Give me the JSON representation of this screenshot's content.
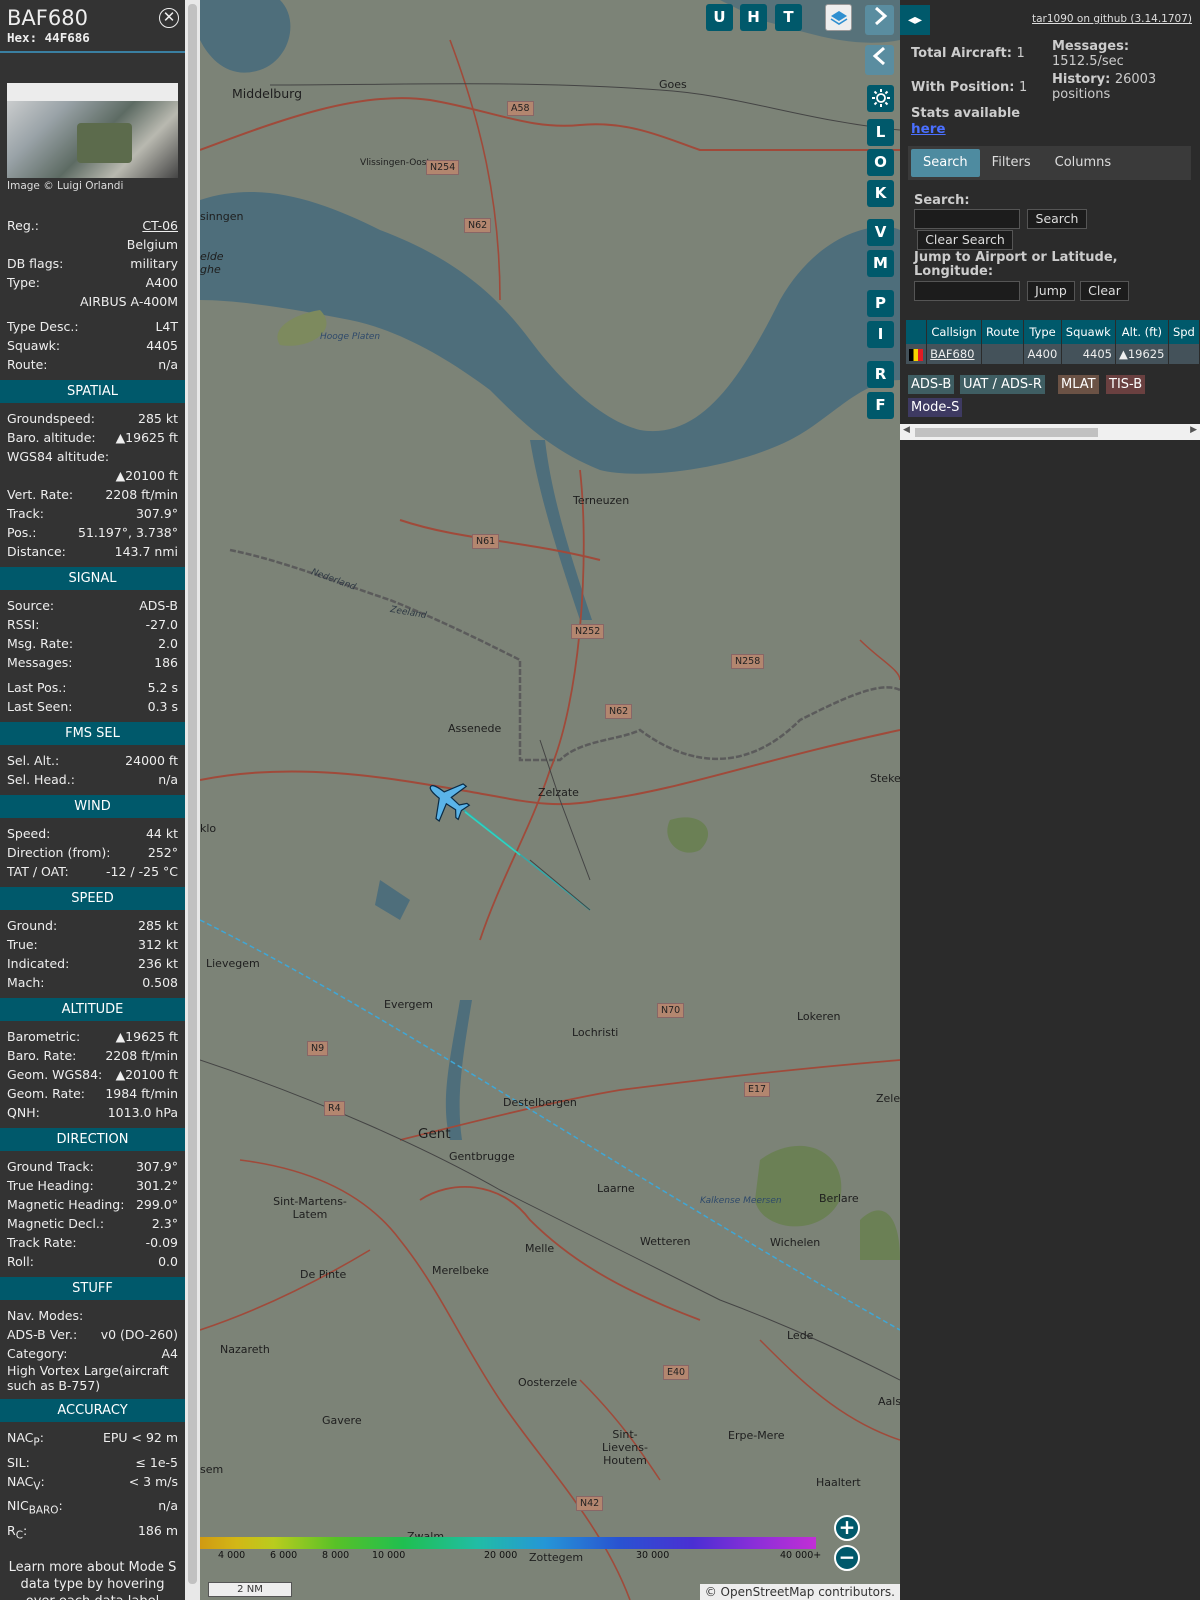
{
  "info": {
    "callsign": "BAF680",
    "hex_label": "Hex:",
    "hex": "44F686",
    "close_icon": "close-icon",
    "photo_credit": "Image © Luigi Orlandi",
    "reg_label": "Reg.:",
    "reg": "CT-06",
    "country": "Belgium",
    "dbflags_label": "DB flags:",
    "dbflags": "military",
    "type_label": "Type:",
    "type": "A400",
    "type_full": "AIRBUS A-400M",
    "typedesc_label": "Type Desc.:",
    "typedesc": "L4T",
    "squawk_label": "Squawk:",
    "squawk": "4405",
    "route_label": "Route:",
    "route": "n/a",
    "footer": "Learn more about Mode S data type by hovering over each data label"
  },
  "spatial": {
    "title": "SPATIAL",
    "groundspeed_label": "Groundspeed:",
    "groundspeed": "285 kt",
    "baro_label": "Baro. altitude:",
    "baro": "▲19625 ft",
    "wgs_label": "WGS84 altitude:",
    "wgs": "▲20100 ft",
    "vrate_label": "Vert. Rate:",
    "vrate": "2208 ft/min",
    "track_label": "Track:",
    "track": "307.9°",
    "pos_label": "Pos.:",
    "pos": "51.197°, 3.738°",
    "dist_label": "Distance:",
    "dist": "143.7 nmi"
  },
  "signal": {
    "title": "SIGNAL",
    "source_label": "Source:",
    "source": "ADS-B",
    "rssi_label": "RSSI:",
    "rssi": "-27.0",
    "msgrate_label": "Msg. Rate:",
    "msgrate": "2.0",
    "messages_label": "Messages:",
    "messages": "186",
    "lastpos_label": "Last Pos.:",
    "lastpos": "5.2 s",
    "lastseen_label": "Last Seen:",
    "lastseen": "0.3 s"
  },
  "fms": {
    "title": "FMS SEL",
    "selalt_label": "Sel. Alt.:",
    "selalt": "24000 ft",
    "selhead_label": "Sel. Head.:",
    "selhead": "n/a"
  },
  "wind": {
    "title": "WIND",
    "speed_label": "Speed:",
    "speed": "44 kt",
    "dir_label": "Direction (from):",
    "dir": "252°",
    "tat_label": "TAT / OAT:",
    "tat": "-12 / -25 °C"
  },
  "speed": {
    "title": "SPEED",
    "ground_label": "Ground:",
    "ground": "285 kt",
    "true_label": "True:",
    "true": "312 kt",
    "ind_label": "Indicated:",
    "ind": "236 kt",
    "mach_label": "Mach:",
    "mach": "0.508"
  },
  "altitude": {
    "title": "ALTITUDE",
    "baro_label": "Barometric:",
    "baro": "▲19625 ft",
    "barorate_label": "Baro. Rate:",
    "barorate": "2208 ft/min",
    "geom_label": "Geom. WGS84:",
    "geom": "▲20100 ft",
    "geomrate_label": "Geom. Rate:",
    "geomrate": "1984 ft/min",
    "qnh_label": "QNH:",
    "qnh": "1013.0 hPa"
  },
  "direction": {
    "title": "DIRECTION",
    "gt_label": "Ground Track:",
    "gt": "307.9°",
    "th_label": "True Heading:",
    "th": "301.2°",
    "mh_label": "Magnetic Heading:",
    "mh": "299.0°",
    "md_label": "Magnetic Decl.:",
    "md": "2.3°",
    "tr_label": "Track Rate:",
    "tr": "-0.09",
    "roll_label": "Roll:",
    "roll": "0.0"
  },
  "stuff": {
    "title": "STUFF",
    "nav_label": "Nav. Modes:",
    "adsb_label": "ADS-B Ver.:",
    "adsb": "v0 (DO-260)",
    "cat_label": "Category:",
    "cat": "A4",
    "cat_desc": "High Vortex Large(aircraft such as B-757)"
  },
  "accuracy": {
    "title": "ACCURACY",
    "nacp_label": "NAC",
    "nacp_sub": "P",
    "nacp": "EPU < 92 m",
    "sil_label": "SIL:",
    "sil": "≤ 1e-5",
    "nacv_label": "NAC",
    "nacv_sub": "V",
    "nacv": "< 3 m/s",
    "nic_label": "NIC",
    "nic_sub": "BARO",
    "nic": "n/a",
    "rc_label": "R",
    "rc_sub": "C",
    "rc": "186 m"
  },
  "map": {
    "buttons_top": [
      "U",
      "H",
      "T"
    ],
    "buttons_side": [
      "L",
      "O",
      "K",
      "V",
      "M",
      "P",
      "I",
      "R",
      "F"
    ],
    "layers_icon": "layers-icon",
    "settings_icon": "gear-icon",
    "zoom_in": "+",
    "zoom_out": "−",
    "alt_ticks": [
      "4 000",
      "6 000",
      "8 000",
      "10 000",
      "20 000",
      "30 000",
      "40 000+"
    ],
    "scale": "2 NM",
    "attribution": "© OpenStreetMap contributors.",
    "places": [
      "Middelburg",
      "Goes",
      "Vlissingen-Oost",
      "Terneuzen",
      "Assenede",
      "Zelzate",
      "Evergem",
      "Lochristi",
      "Lokeren",
      "Gent",
      "Destelbergen",
      "Gentbrugge",
      "Laarne",
      "Berlare",
      "Wetteren",
      "Wichelen",
      "Sint-Martens-Latem",
      "Merelbeke",
      "Melle",
      "De Pinte",
      "Nazareth",
      "Oosterzele",
      "Gavere",
      "Sint-Lievens-Houtem",
      "Erpe-Mere",
      "Lede",
      "Haaltert",
      "Zottegem",
      "Zwalm",
      "Lievegem",
      "Nederland",
      "Zeeland",
      "Hooge Platen",
      "Kalkense Meersen",
      "Steke",
      "Zele",
      "Aals",
      "sinngen",
      "elde ghe",
      "sem",
      "klo"
    ],
    "roads": [
      "A58",
      "N254",
      "N62",
      "N61",
      "N252",
      "N258",
      "N62",
      "N70",
      "N9",
      "R4",
      "E17",
      "E40",
      "N42"
    ]
  },
  "right": {
    "github": "tar1090 on github (3.14.1707)",
    "total_label": "Total Aircraft:",
    "total": "1",
    "withpos_label": "With Position:",
    "withpos": "1",
    "messages_label": "Messages:",
    "messages": "1512.5/sec",
    "history_label": "History:",
    "history": "26003 positions",
    "stats_label": "Stats available",
    "stats_link": "here",
    "tabs": [
      "Search",
      "Filters",
      "Columns"
    ],
    "search_label": "Search:",
    "search_btn": "Search",
    "clear_search_btn": "Clear Search",
    "jump_label": "Jump to Airport or Latitude, Longitude:",
    "jump_btn": "Jump",
    "clear_btn": "Clear",
    "table": {
      "headers": [
        "",
        "Callsign",
        "Route",
        "Type",
        "Squawk",
        "Alt. (ft)",
        "Spd"
      ],
      "row": {
        "callsign": "BAF680",
        "route": "",
        "type": "A400",
        "squawk": "4405",
        "alt": "▲19625"
      }
    },
    "chips": [
      "ADS-B",
      "UAT / ADS-R",
      "MLAT",
      "TIS-B",
      "Mode-S"
    ]
  }
}
